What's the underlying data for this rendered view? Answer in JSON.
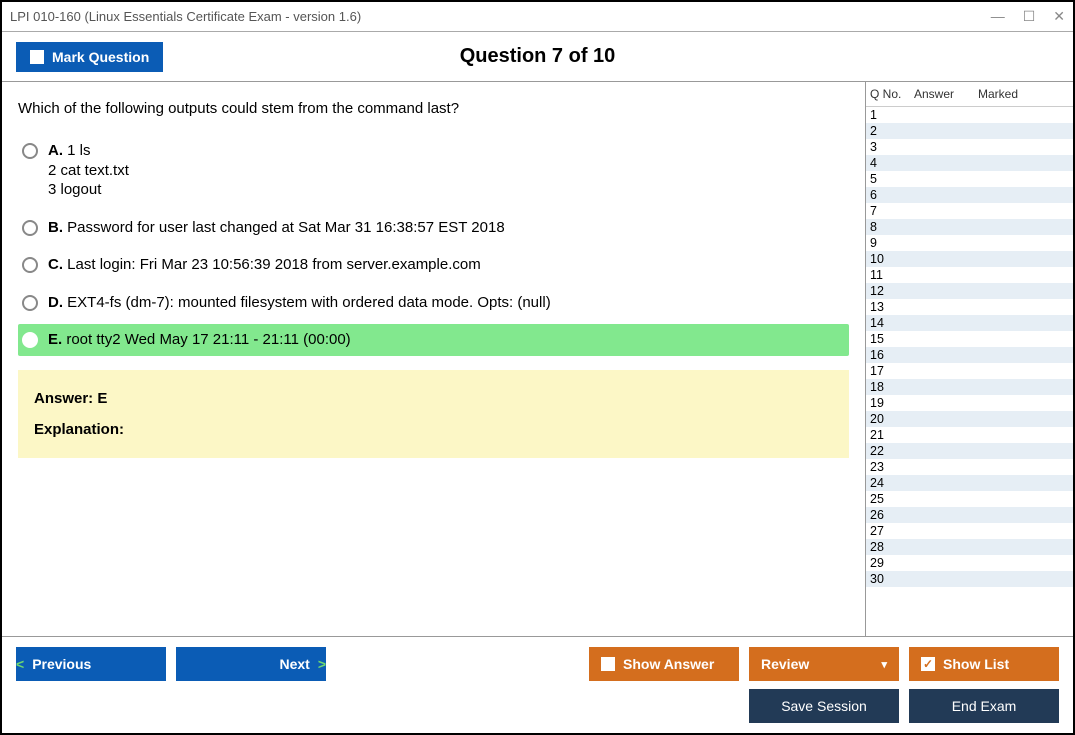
{
  "titlebar": {
    "title": "LPI 010-160 (Linux Essentials Certificate Exam - version 1.6)"
  },
  "header": {
    "mark_button": "Mark Question",
    "question_counter": "Question 7 of 10"
  },
  "question": {
    "text": "Which of the following outputs could stem from the command last?",
    "options": [
      {
        "letter": "A.",
        "text": "1 ls\n2 cat text.txt\n3 logout",
        "correct": false
      },
      {
        "letter": "B.",
        "text": "Password for user last changed at Sat Mar 31 16:38:57 EST 2018",
        "correct": false
      },
      {
        "letter": "C.",
        "text": "Last login: Fri Mar 23 10:56:39 2018 from server.example.com",
        "correct": false
      },
      {
        "letter": "D.",
        "text": "EXT4-fs (dm-7): mounted filesystem with ordered data mode. Opts: (null)",
        "correct": false
      },
      {
        "letter": "E.",
        "text": "root tty2 Wed May 17 21:11 - 21:11 (00:00)",
        "correct": true
      }
    ]
  },
  "answer_box": {
    "answer_label": "Answer: E",
    "explanation_label": "Explanation:"
  },
  "sidebar": {
    "col_qno": "Q No.",
    "col_answer": "Answer",
    "col_marked": "Marked",
    "rows": [
      1,
      2,
      3,
      4,
      5,
      6,
      7,
      8,
      9,
      10,
      11,
      12,
      13,
      14,
      15,
      16,
      17,
      18,
      19,
      20,
      21,
      22,
      23,
      24,
      25,
      26,
      27,
      28,
      29,
      30
    ]
  },
  "footer": {
    "previous": "Previous",
    "next": "Next",
    "show_answer": "Show Answer",
    "review": "Review",
    "show_list": "Show List",
    "save_session": "Save Session",
    "end_exam": "End Exam"
  }
}
